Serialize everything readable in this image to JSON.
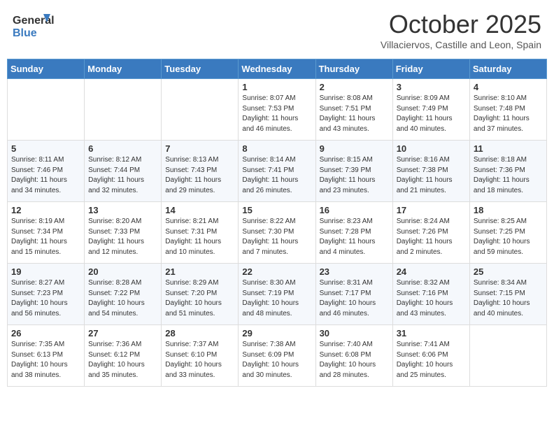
{
  "header": {
    "logo_line1": "General",
    "logo_line2": "Blue",
    "title": "October 2025",
    "subtitle": "Villaciervos, Castille and Leon, Spain"
  },
  "days_of_week": [
    "Sunday",
    "Monday",
    "Tuesday",
    "Wednesday",
    "Thursday",
    "Friday",
    "Saturday"
  ],
  "weeks": [
    [
      {
        "day": "",
        "info": ""
      },
      {
        "day": "",
        "info": ""
      },
      {
        "day": "",
        "info": ""
      },
      {
        "day": "1",
        "info": "Sunrise: 8:07 AM\nSunset: 7:53 PM\nDaylight: 11 hours\nand 46 minutes."
      },
      {
        "day": "2",
        "info": "Sunrise: 8:08 AM\nSunset: 7:51 PM\nDaylight: 11 hours\nand 43 minutes."
      },
      {
        "day": "3",
        "info": "Sunrise: 8:09 AM\nSunset: 7:49 PM\nDaylight: 11 hours\nand 40 minutes."
      },
      {
        "day": "4",
        "info": "Sunrise: 8:10 AM\nSunset: 7:48 PM\nDaylight: 11 hours\nand 37 minutes."
      }
    ],
    [
      {
        "day": "5",
        "info": "Sunrise: 8:11 AM\nSunset: 7:46 PM\nDaylight: 11 hours\nand 34 minutes."
      },
      {
        "day": "6",
        "info": "Sunrise: 8:12 AM\nSunset: 7:44 PM\nDaylight: 11 hours\nand 32 minutes."
      },
      {
        "day": "7",
        "info": "Sunrise: 8:13 AM\nSunset: 7:43 PM\nDaylight: 11 hours\nand 29 minutes."
      },
      {
        "day": "8",
        "info": "Sunrise: 8:14 AM\nSunset: 7:41 PM\nDaylight: 11 hours\nand 26 minutes."
      },
      {
        "day": "9",
        "info": "Sunrise: 8:15 AM\nSunset: 7:39 PM\nDaylight: 11 hours\nand 23 minutes."
      },
      {
        "day": "10",
        "info": "Sunrise: 8:16 AM\nSunset: 7:38 PM\nDaylight: 11 hours\nand 21 minutes."
      },
      {
        "day": "11",
        "info": "Sunrise: 8:18 AM\nSunset: 7:36 PM\nDaylight: 11 hours\nand 18 minutes."
      }
    ],
    [
      {
        "day": "12",
        "info": "Sunrise: 8:19 AM\nSunset: 7:34 PM\nDaylight: 11 hours\nand 15 minutes."
      },
      {
        "day": "13",
        "info": "Sunrise: 8:20 AM\nSunset: 7:33 PM\nDaylight: 11 hours\nand 12 minutes."
      },
      {
        "day": "14",
        "info": "Sunrise: 8:21 AM\nSunset: 7:31 PM\nDaylight: 11 hours\nand 10 minutes."
      },
      {
        "day": "15",
        "info": "Sunrise: 8:22 AM\nSunset: 7:30 PM\nDaylight: 11 hours\nand 7 minutes."
      },
      {
        "day": "16",
        "info": "Sunrise: 8:23 AM\nSunset: 7:28 PM\nDaylight: 11 hours\nand 4 minutes."
      },
      {
        "day": "17",
        "info": "Sunrise: 8:24 AM\nSunset: 7:26 PM\nDaylight: 11 hours\nand 2 minutes."
      },
      {
        "day": "18",
        "info": "Sunrise: 8:25 AM\nSunset: 7:25 PM\nDaylight: 10 hours\nand 59 minutes."
      }
    ],
    [
      {
        "day": "19",
        "info": "Sunrise: 8:27 AM\nSunset: 7:23 PM\nDaylight: 10 hours\nand 56 minutes."
      },
      {
        "day": "20",
        "info": "Sunrise: 8:28 AM\nSunset: 7:22 PM\nDaylight: 10 hours\nand 54 minutes."
      },
      {
        "day": "21",
        "info": "Sunrise: 8:29 AM\nSunset: 7:20 PM\nDaylight: 10 hours\nand 51 minutes."
      },
      {
        "day": "22",
        "info": "Sunrise: 8:30 AM\nSunset: 7:19 PM\nDaylight: 10 hours\nand 48 minutes."
      },
      {
        "day": "23",
        "info": "Sunrise: 8:31 AM\nSunset: 7:17 PM\nDaylight: 10 hours\nand 46 minutes."
      },
      {
        "day": "24",
        "info": "Sunrise: 8:32 AM\nSunset: 7:16 PM\nDaylight: 10 hours\nand 43 minutes."
      },
      {
        "day": "25",
        "info": "Sunrise: 8:34 AM\nSunset: 7:15 PM\nDaylight: 10 hours\nand 40 minutes."
      }
    ],
    [
      {
        "day": "26",
        "info": "Sunrise: 7:35 AM\nSunset: 6:13 PM\nDaylight: 10 hours\nand 38 minutes."
      },
      {
        "day": "27",
        "info": "Sunrise: 7:36 AM\nSunset: 6:12 PM\nDaylight: 10 hours\nand 35 minutes."
      },
      {
        "day": "28",
        "info": "Sunrise: 7:37 AM\nSunset: 6:10 PM\nDaylight: 10 hours\nand 33 minutes."
      },
      {
        "day": "29",
        "info": "Sunrise: 7:38 AM\nSunset: 6:09 PM\nDaylight: 10 hours\nand 30 minutes."
      },
      {
        "day": "30",
        "info": "Sunrise: 7:40 AM\nSunset: 6:08 PM\nDaylight: 10 hours\nand 28 minutes."
      },
      {
        "day": "31",
        "info": "Sunrise: 7:41 AM\nSunset: 6:06 PM\nDaylight: 10 hours\nand 25 minutes."
      },
      {
        "day": "",
        "info": ""
      }
    ]
  ]
}
